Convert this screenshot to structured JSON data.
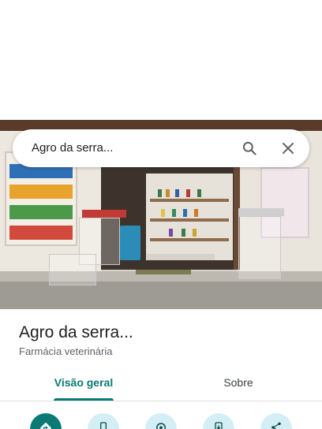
{
  "search": {
    "query": "Agro da serra..."
  },
  "place": {
    "title": "Agro da serra...",
    "category": "Farmácia veterinária"
  },
  "tabs": [
    {
      "label": "Visão geral",
      "active": true
    },
    {
      "label": "Sobre",
      "active": false
    }
  ],
  "actions": [
    {
      "icon": "directions-icon",
      "style": "primary"
    },
    {
      "icon": "phone-icon",
      "style": "secondary"
    },
    {
      "icon": "location-icon",
      "style": "secondary"
    },
    {
      "icon": "add-to-phone-icon",
      "style": "secondary"
    },
    {
      "icon": "share-icon",
      "style": "secondary"
    }
  ],
  "colors": {
    "accent": "#0b7a75",
    "action_bg": "#d3eef4",
    "text_primary": "#202124",
    "text_secondary": "#5f6368"
  }
}
